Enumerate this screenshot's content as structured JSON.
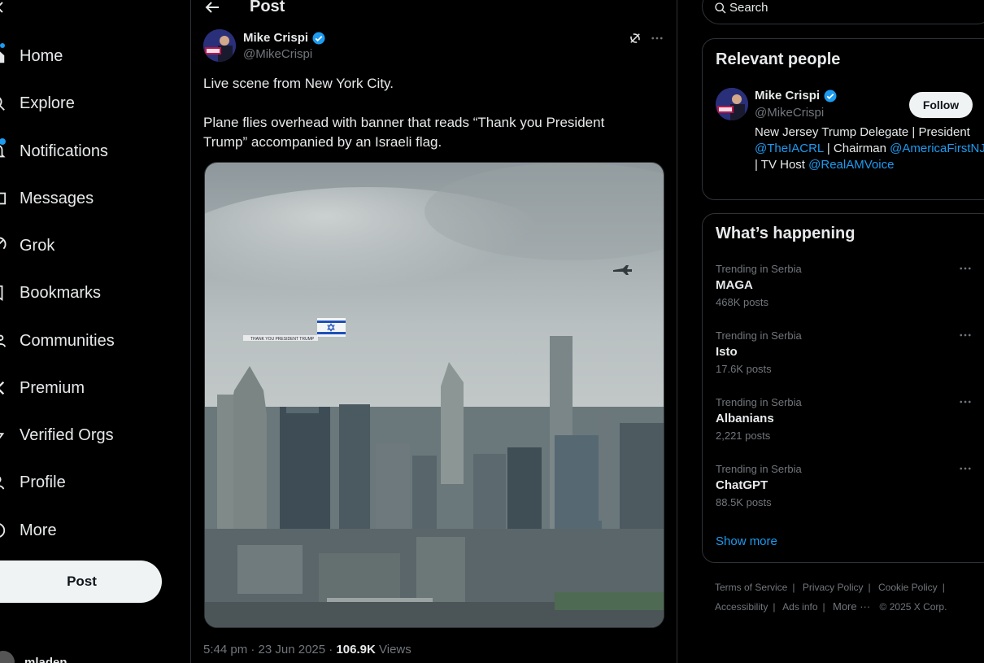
{
  "nav": {
    "items": [
      {
        "label": "Home",
        "icon": "home-icon"
      },
      {
        "label": "Explore",
        "icon": "search-icon"
      },
      {
        "label": "Notifications",
        "icon": "bell-icon"
      },
      {
        "label": "Messages",
        "icon": "envelope-icon"
      },
      {
        "label": "Grok",
        "icon": "grok-icon"
      },
      {
        "label": "Bookmarks",
        "icon": "bookmark-icon"
      },
      {
        "label": "Communities",
        "icon": "people-icon"
      },
      {
        "label": "Premium",
        "icon": "x-logo-icon"
      },
      {
        "label": "Verified Orgs",
        "icon": "lightning-icon"
      },
      {
        "label": "Profile",
        "icon": "person-icon"
      },
      {
        "label": "More",
        "icon": "more-circle-icon"
      }
    ],
    "post_button": "Post",
    "account_name": "mladen"
  },
  "header": {
    "title": "Post"
  },
  "tweet": {
    "author_name": "Mike Crispi",
    "author_handle": "@MikeCrispi",
    "text_line1": "Live scene from New York City.",
    "text_line2": "Plane flies overhead with banner that reads “Thank you President Trump” accompanied by an Israeli flag.",
    "banner_text": "THANK YOU PRESIDENT TRUMP",
    "timestamp": "5:44 pm · 23 Jun 2025",
    "separator": " · ",
    "views_count": "106.9K",
    "views_label": "Views"
  },
  "search": {
    "placeholder": "Search"
  },
  "relevant_people": {
    "title": "Relevant people",
    "name": "Mike Crispi",
    "handle": "@MikeCrispi",
    "follow_label": "Follow",
    "bio_part1": "New Jersey Trump Delegate | President ",
    "bio_mention1": "@TheIACRL",
    "bio_part2": " | Chairman ",
    "bio_mention2": "@AmericaFirstNJ",
    "bio_part3": " | TV Host ",
    "bio_mention3": "@RealAMVoice"
  },
  "happening": {
    "title": "What’s happening",
    "trends": [
      {
        "context": "Trending in Serbia",
        "name": "MAGA",
        "count": "468K posts"
      },
      {
        "context": "Trending in Serbia",
        "name": "Isto",
        "count": "17.6K posts"
      },
      {
        "context": "Trending in Serbia",
        "name": "Albanians",
        "count": "2,221 posts"
      },
      {
        "context": "Trending in Serbia",
        "name": "ChatGPT",
        "count": "88.5K posts"
      }
    ],
    "show_more": "Show more"
  },
  "footer": {
    "terms": "Terms of Service",
    "privacy": "Privacy Policy",
    "cookie": "Cookie Policy",
    "accessibility": "Accessibility",
    "ads": "Ads info",
    "more": "More ···",
    "copyright": "© 2025 X Corp.",
    "separator": "|"
  },
  "colors": {
    "accent": "#1d9bf0",
    "background": "#000000",
    "border": "#2f3336",
    "muted_text": "#71767b"
  }
}
